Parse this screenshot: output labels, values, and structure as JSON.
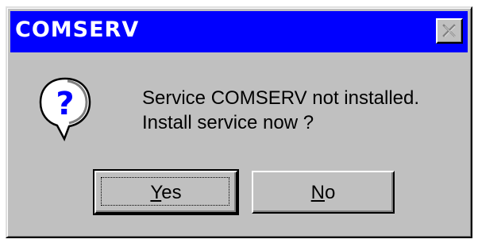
{
  "dialog": {
    "title": "COMSERV",
    "close_icon": "close-x-icon",
    "message_icon": "question-mark-icon",
    "message_line1": "Service COMSERV  not installed.",
    "message_line2": "Install service now ?",
    "buttons": {
      "yes": {
        "label_mnemonic": "Y",
        "label_rest": "es",
        "default": true
      },
      "no": {
        "label_mnemonic": "N",
        "label_rest": "o"
      }
    }
  },
  "colors": {
    "titlebar": "#0000ff",
    "face": "#c0c0c0",
    "title_text": "#ffffff"
  }
}
